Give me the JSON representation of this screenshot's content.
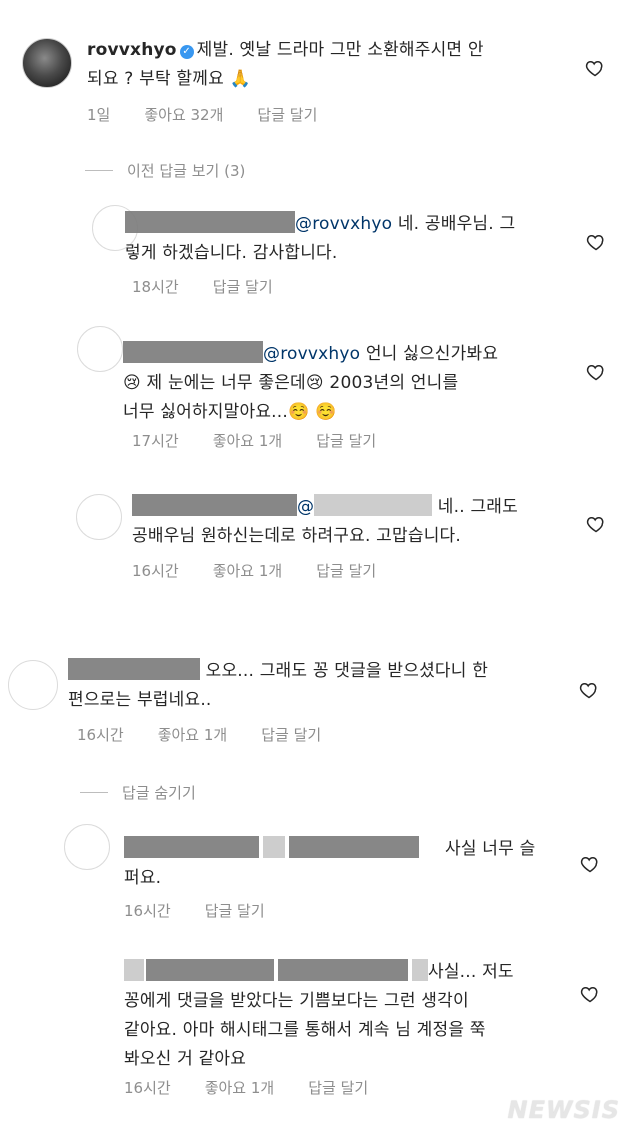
{
  "comments": [
    {
      "username": "rovvxhyo",
      "line1": "제발. 옛날 드라마 그만 소환해주시면 안",
      "line2": "되요 ? 부탁 할께요 🙏",
      "time": "1일",
      "likes": "좋아요 32개",
      "reply": "답글 달기"
    },
    {
      "mention": "@rovvxhyo",
      "line1": " 네. 공배우님. 그",
      "line2": "렇게 하겠습니다. 감사합니다.",
      "time": "18시간",
      "reply": "답글 달기"
    },
    {
      "mention": "@rovvxhyo",
      "line1": " 언니 싫으신가봐요",
      "line2": "😢 제 눈에는 너무 좋은데😢 2003년의 언니를",
      "line3": "너무 싫어하지말아요...☺️ ☺️",
      "time": "17시간",
      "likes": "좋아요 1개",
      "reply": "답글 달기"
    },
    {
      "mention": "@",
      "line1": " 네.. 그래도",
      "line2": "공배우님 원하신는데로 하려구요. 고맙습니다.",
      "time": "16시간",
      "likes": "좋아요 1개",
      "reply": "답글 달기"
    },
    {
      "line1": " 오오... 그래도 꽁 댓글을 받으셨다니 한",
      "line2": "편으로는 부럽네요..",
      "time": "16시간",
      "likes": "좋아요 1개",
      "reply": "답글 달기"
    },
    {
      "line1": "사실 너무 슬",
      "line2": "퍼요.",
      "time": "16시간",
      "reply": "답글 달기"
    },
    {
      "line1": "사실... 저도",
      "line2": "꽁에게 댓글을 받았다는 기쁨보다는 그런 생각이",
      "line3": "같아요. 아마 해시태그를 통해서 계속 님 계정을 쭉",
      "line4": "봐오신 거 같아요",
      "time": "16시간",
      "likes": "좋아요 1개",
      "reply": "답글 달기"
    }
  ],
  "threads": {
    "view_previous": "이전 답글 보기 (3)",
    "hide_replies": "답글 숨기기"
  },
  "watermark": "NEWSIS",
  "colors": {
    "text": "#262626",
    "meta": "#8e8e8e",
    "mention": "#003569",
    "verified": "#3897f0"
  },
  "icons": {
    "like": "heart-icon",
    "verified": "verified-badge-icon"
  }
}
